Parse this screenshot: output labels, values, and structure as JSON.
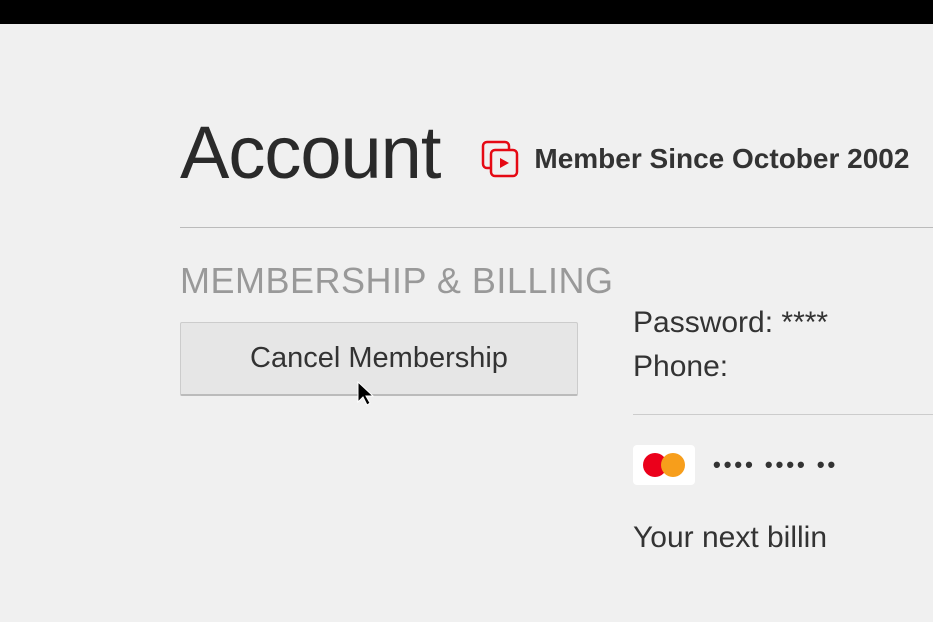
{
  "header": {
    "title": "Account",
    "member_since": "Member Since October 2002"
  },
  "section": {
    "title": "MEMBERSHIP & BILLING",
    "cancel_label": "Cancel Membership"
  },
  "info": {
    "password_label": "Password: ",
    "password_value": "****",
    "phone_label": "Phone:",
    "phone_value": "",
    "card_masked": "•••• •••• ••",
    "next_billing": "Your next billin"
  }
}
